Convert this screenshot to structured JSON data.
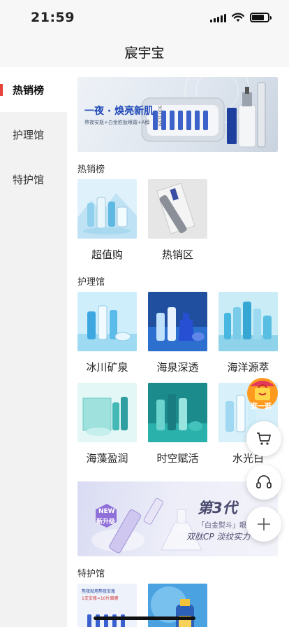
{
  "status_bar": {
    "time": "21:59"
  },
  "header": {
    "title": "宸宇宝"
  },
  "sidebar": {
    "items": [
      {
        "label": "热销榜",
        "active": true
      },
      {
        "label": "护理馆",
        "active": false
      },
      {
        "label": "特护馆",
        "active": false
      }
    ]
  },
  "banner_top": {
    "headline": "一夜 · 焕亮新肌",
    "subline": "熬夜安瓶+白金胜肽眼霜+A醇",
    "brand": "WETCODE"
  },
  "sections": {
    "hot": {
      "title": "热销榜",
      "items": [
        {
          "label": "超值购"
        },
        {
          "label": "热销区"
        }
      ]
    },
    "care": {
      "title": "护理馆",
      "items": [
        {
          "label": "冰川矿泉"
        },
        {
          "label": "海泉深透"
        },
        {
          "label": "海洋源萃"
        },
        {
          "label": "海藻盈润"
        },
        {
          "label": "时空赋活"
        },
        {
          "label": "水光白"
        }
      ]
    },
    "special": {
      "title": "特护馆"
    }
  },
  "banner_mid": {
    "badge_top": "NEW",
    "badge_bottom": "新升级",
    "big_text": "第3代",
    "line1": "「白金熨斗」眼霜",
    "line2": "双肽CP 淡纹实力"
  },
  "special_tiles": {
    "line1": "熬夜就用熬夜安瓶",
    "line2": "1支安瓶=10片面膜"
  },
  "floating": {
    "promo_label": "逛一逛"
  },
  "colors": {
    "accent": "#e5433b",
    "sidebar_bg": "#f2f2f2",
    "promo_orange": "#ff9a1f"
  }
}
